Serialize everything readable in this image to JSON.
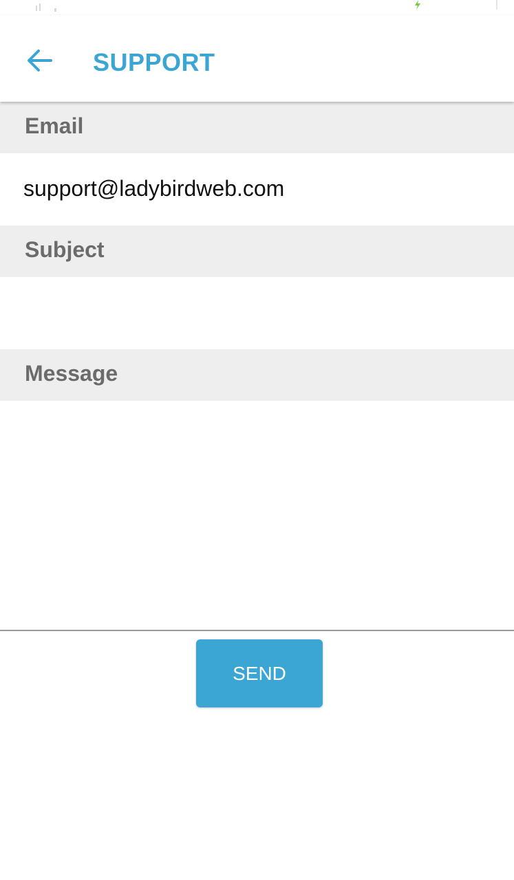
{
  "header": {
    "title": "SUPPORT",
    "back_icon": "arrow-left-icon"
  },
  "colors": {
    "accent": "#3ba6d4",
    "section_bg": "#eeeeee",
    "section_text": "#6b6b6b",
    "charging_icon": "#7ac943"
  },
  "form": {
    "email": {
      "label": "Email",
      "value": "support@ladybirdweb.com"
    },
    "subject": {
      "label": "Subject",
      "value": ""
    },
    "message": {
      "label": "Message",
      "value": ""
    },
    "send_label": "SEND"
  }
}
